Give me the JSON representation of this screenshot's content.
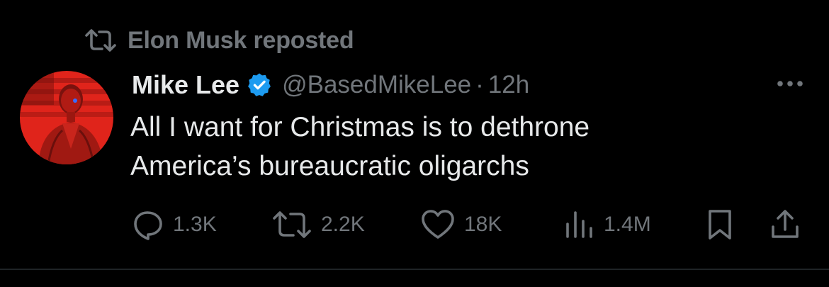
{
  "repost": {
    "icon": "repost-icon",
    "text": "Elon Musk reposted"
  },
  "author": {
    "display_name": "Mike Lee",
    "handle": "@BasedMikeLee",
    "separator": "·",
    "time": "12h",
    "verified": true,
    "verified_color": "#1d9bf0"
  },
  "tweet": {
    "lines": [
      "All I want for Christmas is to dethrone",
      "America’s bureaucratic oligarchs"
    ]
  },
  "actions": {
    "replies": "1.3K",
    "reposts": "2.2K",
    "likes": "18K",
    "views": "1.4M"
  },
  "colors": {
    "background": "#000000",
    "primary_text": "#e7e9ea",
    "secondary_text": "#71767b",
    "avatar_tint": "#e0241b"
  }
}
